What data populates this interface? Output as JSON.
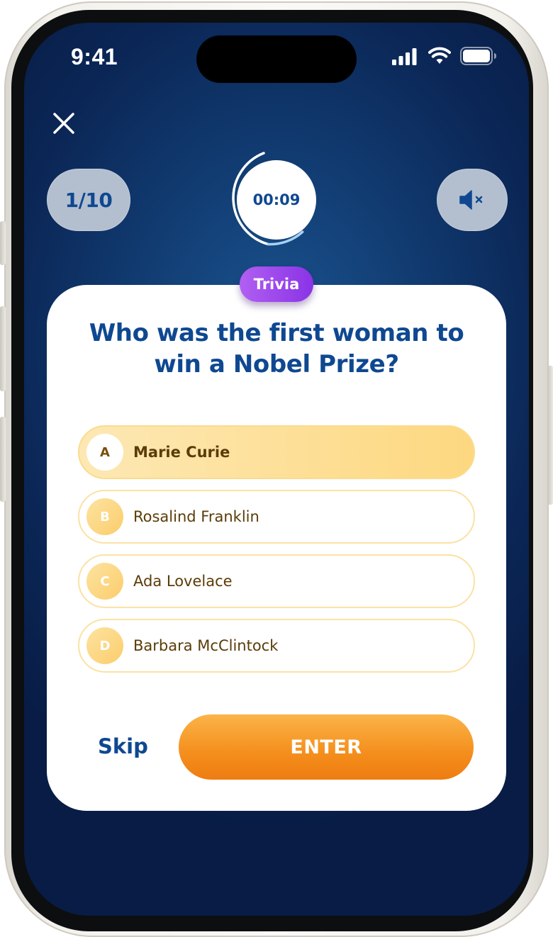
{
  "status_bar": {
    "time": "9:41",
    "icons": [
      "cellular-signal-icon",
      "wifi-icon",
      "battery-icon"
    ]
  },
  "header": {
    "close_icon": "close-icon",
    "progress": "1/10",
    "timer": "00:09",
    "timer_fraction_remaining": 0.75,
    "sound_icon": "speaker-muted-icon"
  },
  "quiz": {
    "category": "Trivia",
    "question": "Who was the first woman to win a Nobel Prize?",
    "answers": [
      {
        "letter": "A",
        "text": "Marie Curie",
        "selected": true
      },
      {
        "letter": "B",
        "text": "Rosalind Franklin",
        "selected": false
      },
      {
        "letter": "C",
        "text": "Ada Lovelace",
        "selected": false
      },
      {
        "letter": "D",
        "text": "Barbara McClintock",
        "selected": false
      }
    ],
    "skip_label": "Skip",
    "enter_label": "ENTER"
  },
  "colors": {
    "primary_blue": "#0f4891",
    "accent_orange": "#f48e1c",
    "answer_highlight": "#fdd880",
    "badge_purple": "#9b44eb",
    "timer_ring": "#ffffff"
  }
}
